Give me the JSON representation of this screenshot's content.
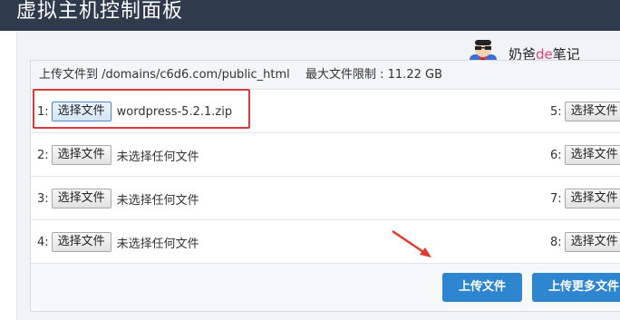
{
  "header": {
    "title": "虚拟主机控制面板"
  },
  "watermark": {
    "text_before": "奶爸",
    "text_accent": "de",
    "text_after": "笔记",
    "accent_color": "#e0457b"
  },
  "upload": {
    "path_label": "上传文件到 /domains/c6d6.com/public_html",
    "limit_label": "最大文件限制 : 11.22 GB",
    "button_label": "选择文件",
    "slots": [
      {
        "num": "1:",
        "status": "wordpress-5.2.1.zip"
      },
      {
        "num": "2:",
        "status": "未选择任何文件"
      },
      {
        "num": "3:",
        "status": "未选择任何文件"
      },
      {
        "num": "4:",
        "status": "未选择任何文件"
      },
      {
        "num": "5:",
        "status": ""
      },
      {
        "num": "6:",
        "status": ""
      },
      {
        "num": "7:",
        "status": ""
      },
      {
        "num": "8:",
        "status": ""
      }
    ],
    "upload_button": "上传文件",
    "upload_more_button": "上传更多文件"
  },
  "colors": {
    "topbar": "#2f3b4c",
    "primary": "#2f86d0",
    "highlight": "#d83a3a"
  }
}
